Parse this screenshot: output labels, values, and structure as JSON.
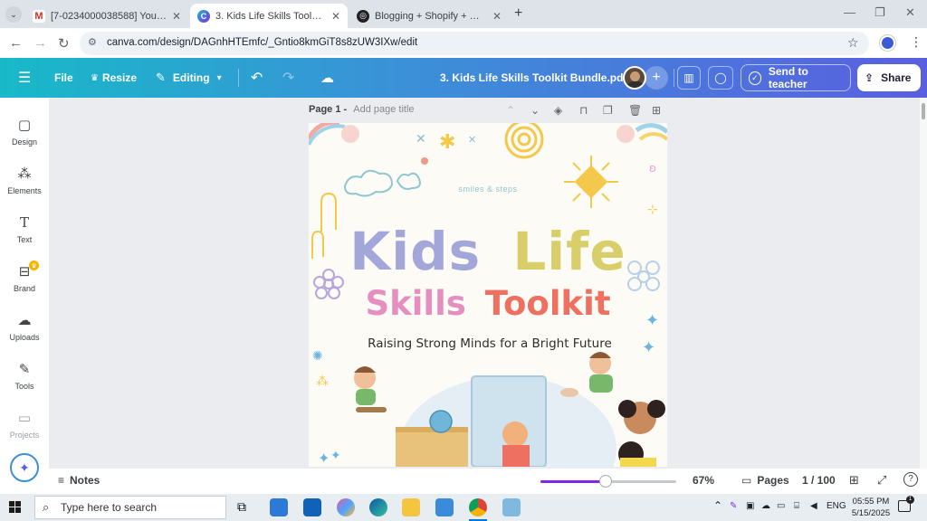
{
  "browser": {
    "tabs": [
      {
        "title": "[7-0234000038588] Your Googl",
        "icon": "gmail-icon",
        "active": false
      },
      {
        "title": "3. Kids Life Skills Toolkit Bundle",
        "icon": "canva-icon",
        "active": true
      },
      {
        "title": "Blogging + Shopify + Gumroad",
        "icon": "chatgpt-icon",
        "active": false
      }
    ],
    "url": "canva.com/design/DAGnhHTEmfc/_Gntio8kmGiT8s8zUW3IXw/edit"
  },
  "header": {
    "file_label": "File",
    "resize_label": "Resize",
    "editing_label": "Editing",
    "doc_title": "3. Kids Life Skills Toolkit Bundle.pdf",
    "send_label": "Send to teacher",
    "share_label": "Share"
  },
  "sidebar": {
    "items": [
      {
        "label": "Design",
        "icon": "design-icon"
      },
      {
        "label": "Elements",
        "icon": "elements-icon"
      },
      {
        "label": "Text",
        "icon": "text-icon"
      },
      {
        "label": "Brand",
        "icon": "brand-icon"
      },
      {
        "label": "Uploads",
        "icon": "uploads-icon"
      },
      {
        "label": "Tools",
        "icon": "tools-icon"
      },
      {
        "label": "Projects",
        "icon": "projects-icon"
      }
    ]
  },
  "page": {
    "page_label": "Page 1 -",
    "title_placeholder": "Add page title",
    "brand_text": "smiles & steps",
    "title_line1_a": "Kids",
    "title_line1_b": "Life",
    "title_line2_a": "Skills",
    "title_line2_b": "Toolkit",
    "subtitle": "Raising Strong Minds for a Bright Future"
  },
  "status": {
    "notes_label": "Notes",
    "zoom": "67%",
    "zoom_fraction": 0.48,
    "pages_label": "Pages",
    "page_count": "1 / 100"
  },
  "taskbar": {
    "search_placeholder": "Type here to search",
    "lang": "ENG",
    "time": "05:55 PM",
    "date": "5/15/2025"
  },
  "colors": {
    "kids": "#a3a6d8",
    "life": "#d8cf6a",
    "skills": "#e48fc0",
    "toolkit": "#ee7060",
    "canva_gradient_start": "#18b9c9",
    "canva_gradient_end": "#5a5fe0"
  }
}
